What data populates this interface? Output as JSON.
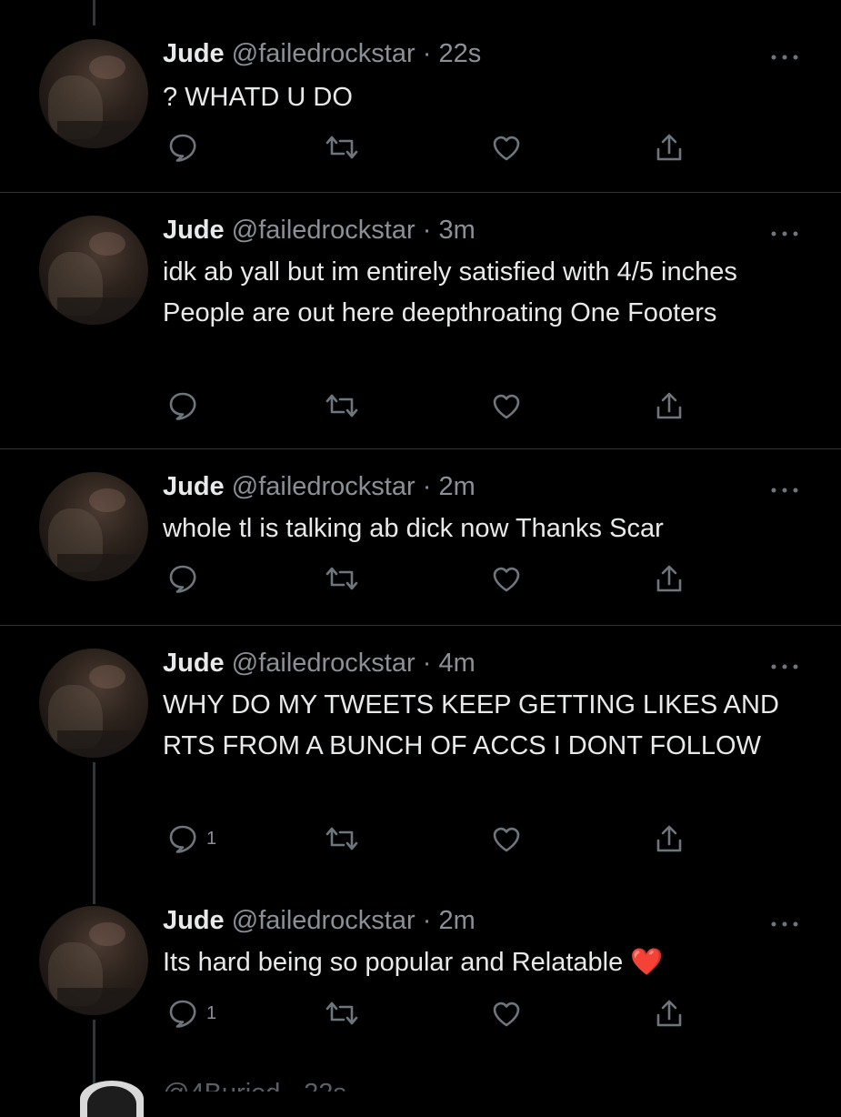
{
  "tweets": [
    {
      "name": "Jude",
      "handle": "@failedrockstar",
      "time": "22s",
      "text": "? WHATD U DO",
      "reply_count": "",
      "has_thread_below": false
    },
    {
      "name": "Jude",
      "handle": "@failedrockstar",
      "time": "3m",
      "text": "idk ab yall but im entirely satisfied with 4/5 inches People are out here deepthroating One Footers",
      "reply_count": "",
      "has_thread_below": false
    },
    {
      "name": "Jude",
      "handle": "@failedrockstar",
      "time": "2m",
      "text": "whole tl is talking ab dick now Thanks Scar",
      "reply_count": "",
      "has_thread_below": false
    },
    {
      "name": "Jude",
      "handle": "@failedrockstar",
      "time": "4m",
      "text": "WHY DO MY TWEETS KEEP GETTING LIKES AND RTS FROM A BUNCH OF ACCS I DONT FOLLOW",
      "reply_count": "1",
      "has_thread_below": true
    },
    {
      "name": "Jude",
      "handle": "@failedrockstar",
      "time": "2m",
      "text": "Its hard being so popular and Relatable ❤️",
      "reply_count": "1",
      "has_thread_below": true
    }
  ],
  "next_tweet_partial": {
    "handle_fragment": "@4Buried · 22s"
  },
  "icons": {
    "reply": "reply-icon",
    "retweet": "retweet-icon",
    "like": "heart-icon",
    "share": "share-icon",
    "more": "more-dots-icon"
  },
  "colors": {
    "background": "#000000",
    "text": "#e7e9ea",
    "muted": "#8b9096",
    "divider": "#2f3336",
    "icon": "#6e767d"
  }
}
